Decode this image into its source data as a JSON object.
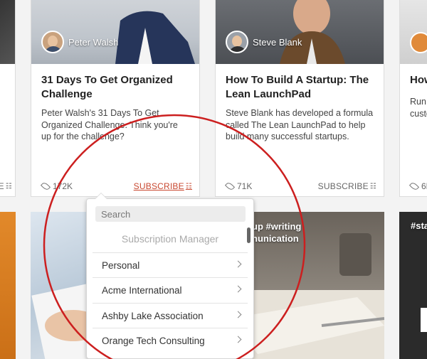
{
  "cards_top": [
    {
      "author": "Peter Walsh",
      "title": "31 Days To Get Organized Challenge",
      "description": "Peter Walsh's 31 Days To Get Organized Challenge. Think you're up for the challenge?",
      "views": "172K",
      "subscribe": "SUBSCRIBE"
    },
    {
      "author": "Steve Blank",
      "title": "How To Build A Startup: The Lean LaunchPad",
      "description": "Steve Blank has developed a formula called The Lean LaunchPad to help build many successful startups.",
      "views": "71K",
      "subscribe": "SUBSCRIBE"
    }
  ],
  "right_partial_card": {
    "title": "How",
    "description_line1": "Run",
    "description_line2": "custo",
    "views": "6K"
  },
  "left_partial_card": {
    "subscribe_fragment": "E"
  },
  "bottom_tags": {
    "middle_line1": "up  #writing",
    "middle_line2": "nunication",
    "right": "#sta"
  },
  "dropdown": {
    "search_placeholder": "Search",
    "header": "Subscription Manager",
    "items": [
      "Personal",
      "Acme International",
      "Ashby Lake Association",
      "Orange Tech Consulting"
    ]
  },
  "colors": {
    "accent": "#c8472f",
    "highlight_circle": "#cc1f1f"
  }
}
